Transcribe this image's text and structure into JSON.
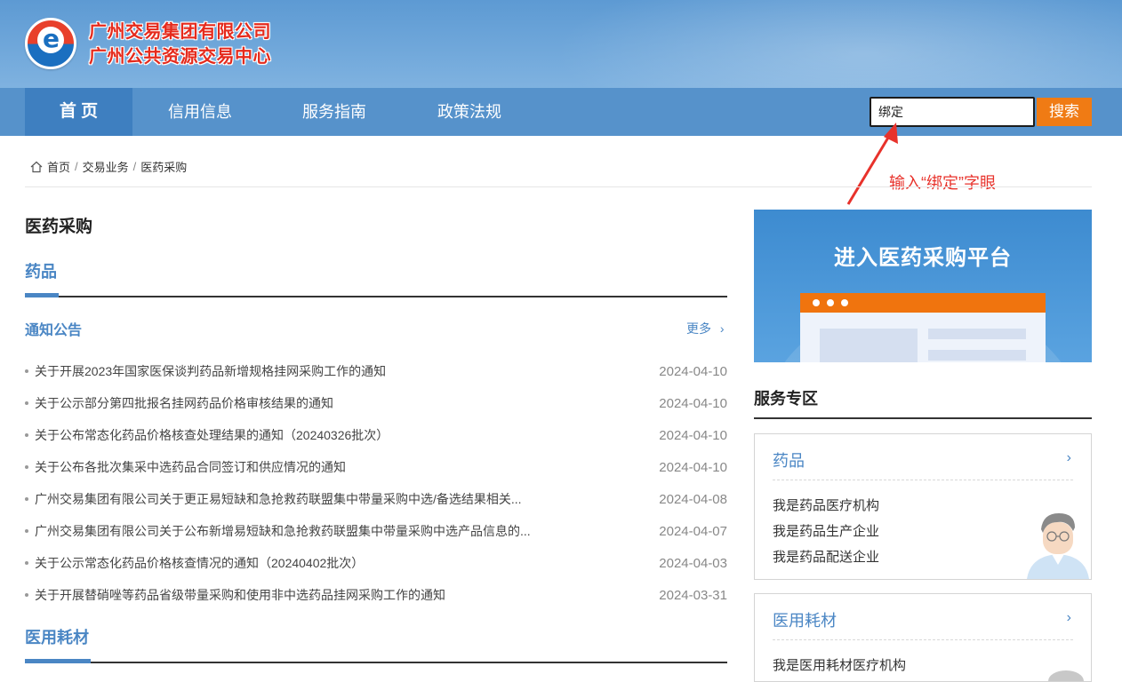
{
  "header": {
    "org_line1": "广州交易集团有限公司",
    "org_line2": "广州公共资源交易中心",
    "logo_icon": "e-logo-icon"
  },
  "nav": {
    "items": [
      {
        "label": "首 页",
        "active": true
      },
      {
        "label": "信用信息",
        "active": false
      },
      {
        "label": "服务指南",
        "active": false
      },
      {
        "label": "政策法规",
        "active": false
      }
    ],
    "search_value": "绑定",
    "search_button": "搜索"
  },
  "breadcrumb": [
    "首页",
    "交易业务",
    "医药采购"
  ],
  "annotation": "输入“绑定”字眼",
  "main": {
    "page_title": "医药采购",
    "category1": "药品",
    "notice_title": "通知公告",
    "more": "更多",
    "news": [
      {
        "title": "关于开展2023年国家医保谈判药品新增规格挂网采购工作的通知",
        "date": "2024-04-10"
      },
      {
        "title": "关于公示部分第四批报名挂网药品价格审核结果的通知",
        "date": "2024-04-10"
      },
      {
        "title": "关于公布常态化药品价格核查处理结果的通知（20240326批次）",
        "date": "2024-04-10"
      },
      {
        "title": "关于公布各批次集采中选药品合同签订和供应情况的通知",
        "date": "2024-04-10"
      },
      {
        "title": "广州交易集团有限公司关于更正易短缺和急抢救药联盟集中带量采购中选/备选结果相关...",
        "date": "2024-04-08"
      },
      {
        "title": "广州交易集团有限公司关于公布新增易短缺和急抢救药联盟集中带量采购中选产品信息的...",
        "date": "2024-04-07"
      },
      {
        "title": "关于公示常态化药品价格核查情况的通知（20240402批次）",
        "date": "2024-04-03"
      },
      {
        "title": "关于开展替硝唑等药品省级带量采购和使用非中选药品挂网采购工作的通知",
        "date": "2024-03-31"
      }
    ],
    "category2": "医用耗材"
  },
  "sidebar": {
    "banner_title": "进入医药采购平台",
    "service_title": "服务专区",
    "cards": [
      {
        "name": "药品",
        "links": [
          "我是药品医疗机构",
          "我是药品生产企业",
          "我是药品配送企业"
        ]
      },
      {
        "name": "医用耗材",
        "links": [
          "我是医用耗材医疗机构"
        ]
      }
    ]
  },
  "colors": {
    "header_blue": "#5d9ad3",
    "nav_blue": "#5692cb",
    "accent_blue": "#4a86c4",
    "orange": "#f07b14",
    "annotation_red": "#e8322b"
  }
}
